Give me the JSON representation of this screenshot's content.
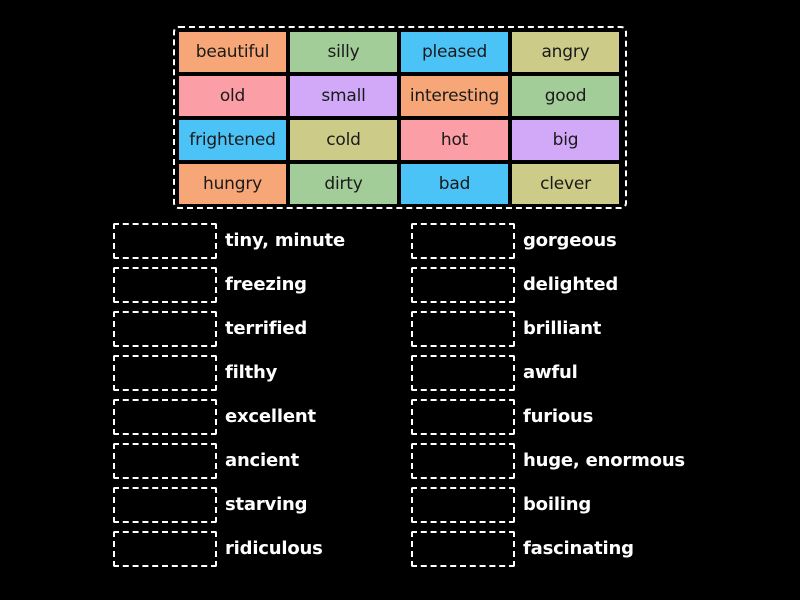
{
  "colors": {
    "background": "#000000",
    "orange": "#f7a777",
    "green": "#a3cd98",
    "blue": "#4cc3f7",
    "olive": "#cdcb88",
    "pink": "#fc9ea5",
    "purple": "#d1a9f8"
  },
  "tiles": [
    {
      "label": "beautiful",
      "color": "orange"
    },
    {
      "label": "silly",
      "color": "green"
    },
    {
      "label": "pleased",
      "color": "blue"
    },
    {
      "label": "angry",
      "color": "olive"
    },
    {
      "label": "old",
      "color": "pink"
    },
    {
      "label": "small",
      "color": "purple"
    },
    {
      "label": "interesting",
      "color": "orange"
    },
    {
      "label": "good",
      "color": "green"
    },
    {
      "label": "frightened",
      "color": "blue"
    },
    {
      "label": "cold",
      "color": "olive"
    },
    {
      "label": "hot",
      "color": "pink"
    },
    {
      "label": "big",
      "color": "purple"
    },
    {
      "label": "hungry",
      "color": "orange"
    },
    {
      "label": "dirty",
      "color": "green"
    },
    {
      "label": "bad",
      "color": "blue"
    },
    {
      "label": "clever",
      "color": "olive"
    }
  ],
  "targets_left": [
    {
      "label": "tiny, minute"
    },
    {
      "label": "freezing"
    },
    {
      "label": "terrified"
    },
    {
      "label": "filthy"
    },
    {
      "label": "excellent"
    },
    {
      "label": "ancient"
    },
    {
      "label": "starving"
    },
    {
      "label": "ridiculous"
    }
  ],
  "targets_right": [
    {
      "label": "gorgeous"
    },
    {
      "label": "delighted"
    },
    {
      "label": "brilliant"
    },
    {
      "label": "awful"
    },
    {
      "label": "furious"
    },
    {
      "label": "huge, enormous"
    },
    {
      "label": "boiling"
    },
    {
      "label": "fascinating"
    }
  ]
}
